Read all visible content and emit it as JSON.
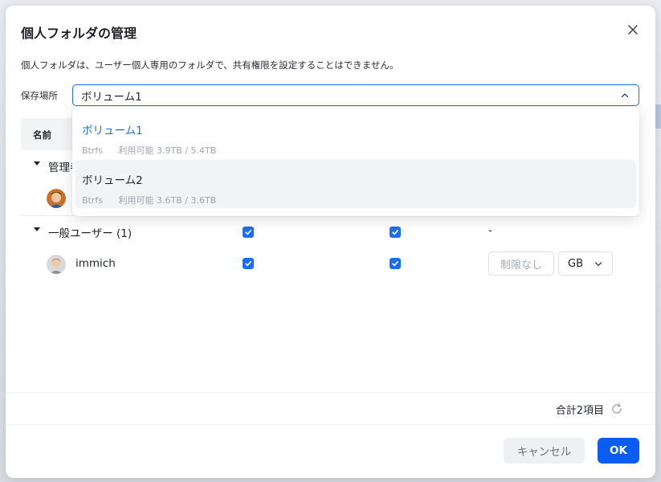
{
  "dialog": {
    "title": "個人フォルダの管理",
    "description": "個人フォルダは、ユーザー個人専用のフォルダで、共有権限を設定することはできません。",
    "close_icon": "close-icon"
  },
  "location": {
    "label": "保存場所",
    "selected": "ボリューム1",
    "options": [
      {
        "name": "ボリューム1",
        "fs": "Btrfs",
        "usage": "利用可能 3.9TB / 5.4TB",
        "selected": true
      },
      {
        "name": "ボリューム2",
        "fs": "Btrfs",
        "usage": "利用可能 3.6TB / 3.6TB",
        "selected": false
      }
    ]
  },
  "table": {
    "header_name": "名前",
    "groups": [
      {
        "label": "管理者",
        "toggle_icon": "caret-down-icon"
      },
      {
        "label": "一般ユーザー (1)",
        "toggle_icon": "caret-down-icon",
        "col3": "-"
      }
    ],
    "users": [
      {
        "name": "immich",
        "quota_placeholder": "制限なし",
        "unit": "GB"
      }
    ]
  },
  "footer": {
    "total": "合計2項目",
    "cancel": "キャンセル",
    "ok": "OK"
  },
  "colors": {
    "accent": "#0b5cf5",
    "checkbox": "#1a6ef5"
  }
}
